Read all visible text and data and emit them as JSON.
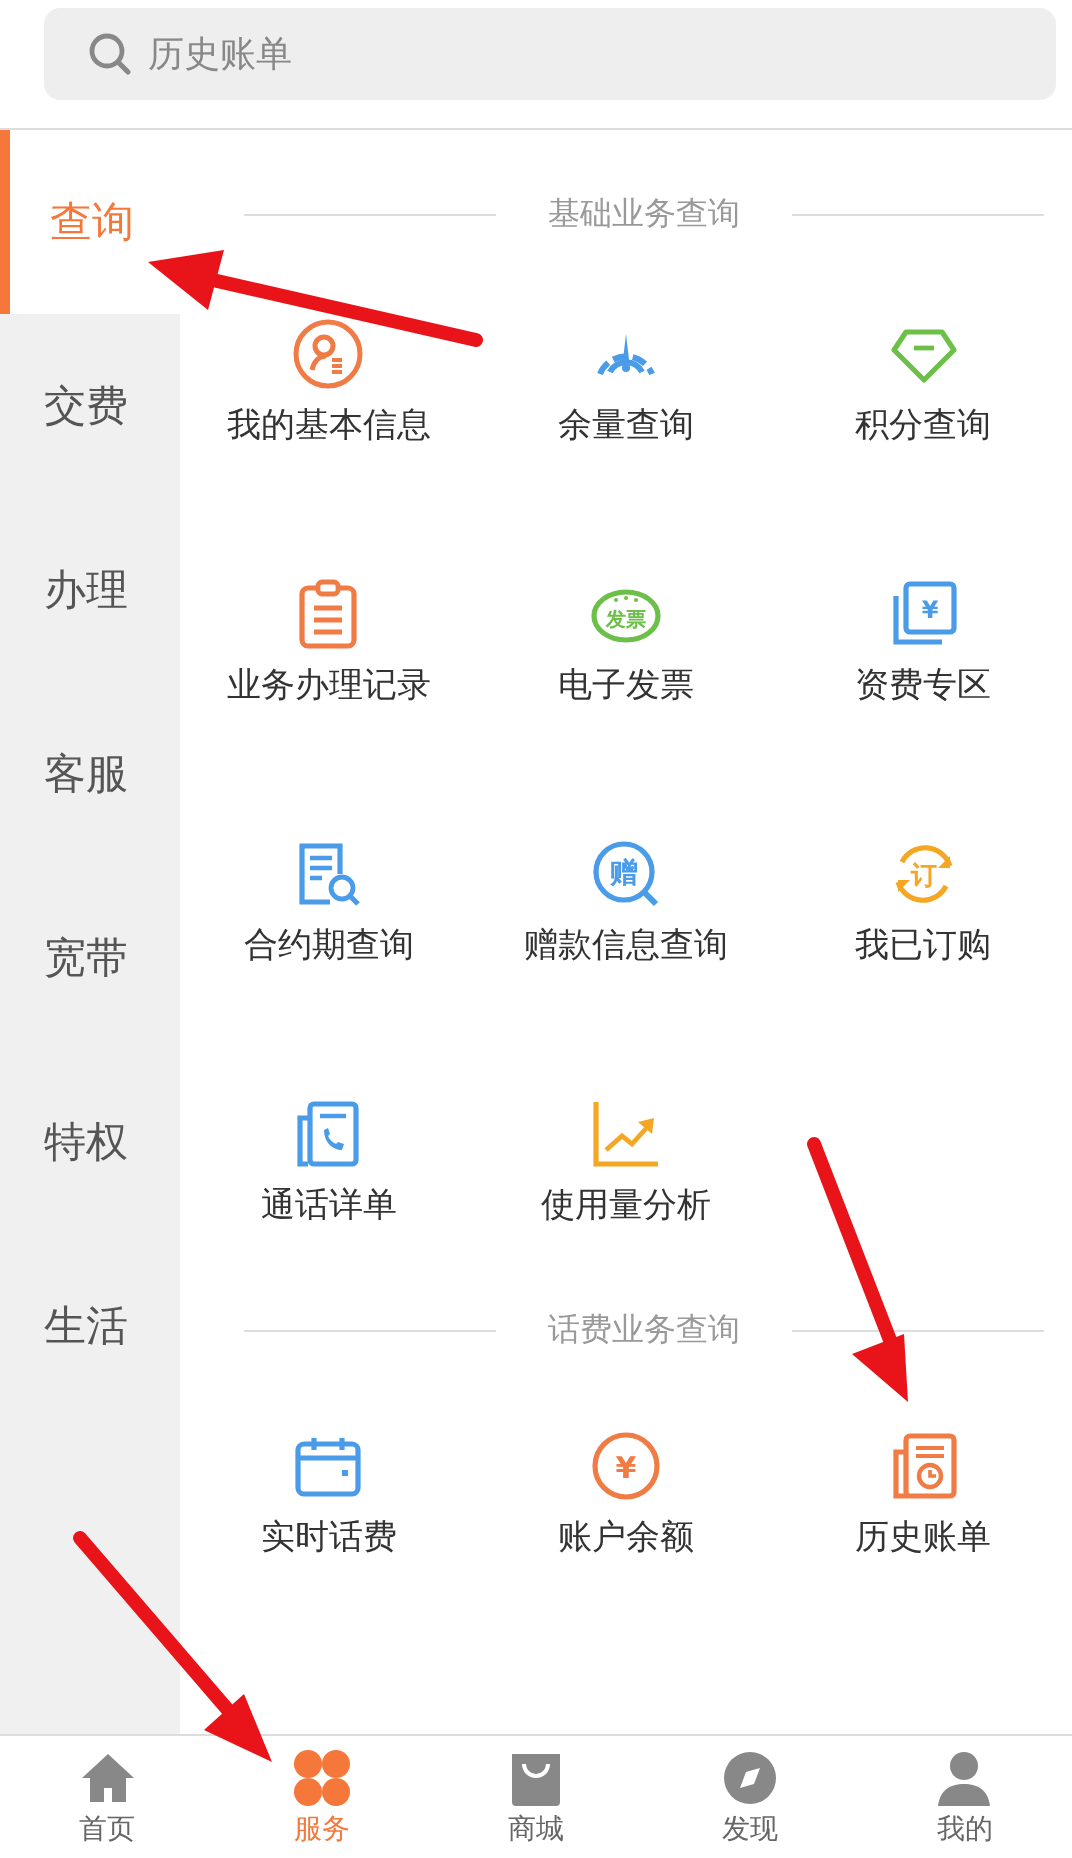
{
  "search": {
    "placeholder": "历史账单"
  },
  "sidebar": {
    "items": [
      {
        "label": "查询",
        "selected": true
      },
      {
        "label": "交费",
        "selected": false
      },
      {
        "label": "办理",
        "selected": false
      },
      {
        "label": "客服",
        "selected": false
      },
      {
        "label": "宽带",
        "selected": false
      },
      {
        "label": "特权",
        "selected": false
      },
      {
        "label": "生活",
        "selected": false
      }
    ]
  },
  "sections": [
    {
      "title": "基础业务查询",
      "items": [
        {
          "label": "我的基本信息"
        },
        {
          "label": "余量查询"
        },
        {
          "label": "积分查询"
        },
        {
          "label": "业务办理记录"
        },
        {
          "label": "电子发票",
          "icon_text": "发票"
        },
        {
          "label": "资费专区",
          "icon_text": "¥"
        },
        {
          "label": "合约期查询"
        },
        {
          "label": "赠款信息查询",
          "icon_text": "赠"
        },
        {
          "label": "我已订购",
          "icon_text": "订"
        },
        {
          "label": "通话详单"
        },
        {
          "label": "使用量分析"
        }
      ]
    },
    {
      "title": "话费业务查询",
      "items": [
        {
          "label": "实时话费"
        },
        {
          "label": "账户余额",
          "icon_text": "¥"
        },
        {
          "label": "历史账单"
        }
      ]
    }
  ],
  "bottom_nav": [
    {
      "label": "首页",
      "selected": false
    },
    {
      "label": "服务",
      "selected": true
    },
    {
      "label": "商城",
      "selected": false
    },
    {
      "label": "发现",
      "selected": false
    },
    {
      "label": "我的",
      "selected": false
    }
  ]
}
